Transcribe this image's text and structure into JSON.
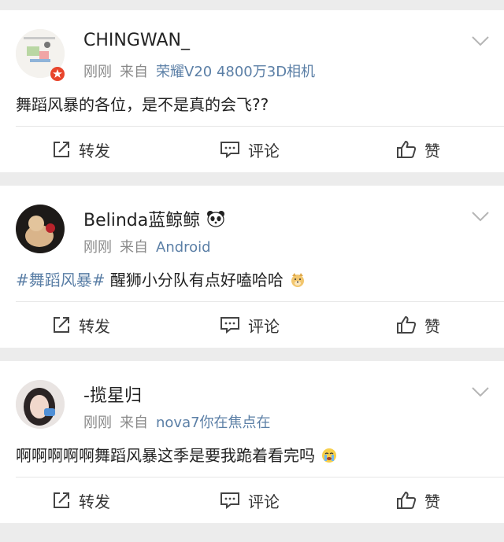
{
  "posts": [
    {
      "username": "CHINGWAN_",
      "time": "刚刚",
      "from_label": "来自",
      "source": "荣耀V20 4800万3D相机",
      "content": "舞蹈风暴的各位，是不是真的会飞??",
      "actions": {
        "repost": "转发",
        "comment": "评论",
        "like": "赞"
      }
    },
    {
      "username": "Belinda蓝鲸鲸",
      "time": "刚刚",
      "from_label": "来自",
      "source": "Android",
      "hashtag": "#舞蹈风暴#",
      "content": " 醒狮小分队有点好嗑哈哈",
      "actions": {
        "repost": "转发",
        "comment": "评论",
        "like": "赞"
      }
    },
    {
      "username": "-揽星归",
      "time": "刚刚",
      "from_label": "来自",
      "source": "nova7你在焦点在",
      "content": "啊啊啊啊啊舞蹈风暴这季是要我跪着看完吗",
      "actions": {
        "repost": "转发",
        "comment": "评论",
        "like": "赞"
      }
    }
  ],
  "colors": {
    "link": "#5b7fa6",
    "meta": "#8a8a8a",
    "badge": "#e8452c",
    "background": "#ececec"
  },
  "icons": [
    "repost-icon",
    "comment-icon",
    "like-icon",
    "chevron-down-icon",
    "panda-emoji",
    "doge-emoji",
    "crying-emoji",
    "verified-badge-icon"
  ]
}
